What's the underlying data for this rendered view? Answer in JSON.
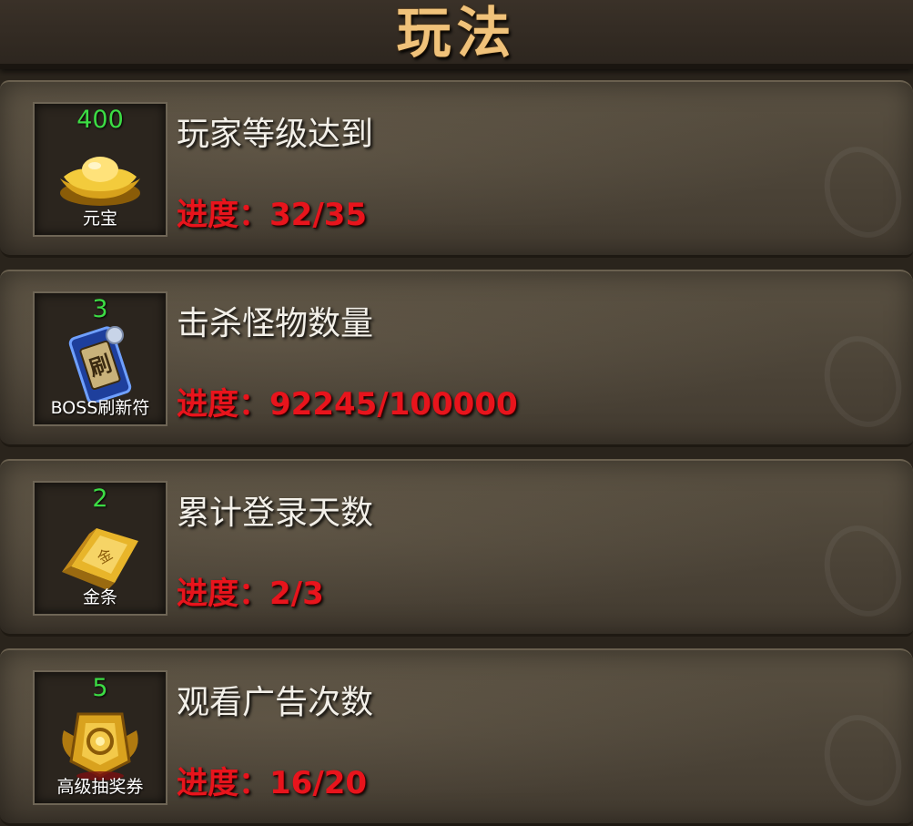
{
  "header": {
    "title": "玩法"
  },
  "tasks": [
    {
      "title": "玩家等级达到",
      "progress_label": "进度：",
      "progress": "32/35",
      "reward": {
        "qty": "400",
        "name": "元宝",
        "icon": "gold-ingot-icon"
      }
    },
    {
      "title": "击杀怪物数量",
      "progress_label": "进度：",
      "progress": "92245/100000",
      "reward": {
        "qty": "3",
        "name": "BOSS刷新符",
        "icon": "boss-refresh-talisman-icon"
      }
    },
    {
      "title": "累计登录天数",
      "progress_label": "进度：",
      "progress": "2/3",
      "reward": {
        "qty": "2",
        "name": "金条",
        "icon": "gold-bar-icon"
      }
    },
    {
      "title": "观看广告次数",
      "progress_label": "进度：",
      "progress": "16/20",
      "reward": {
        "qty": "5",
        "name": "高级抽奖券",
        "icon": "lottery-ticket-icon"
      }
    }
  ]
}
